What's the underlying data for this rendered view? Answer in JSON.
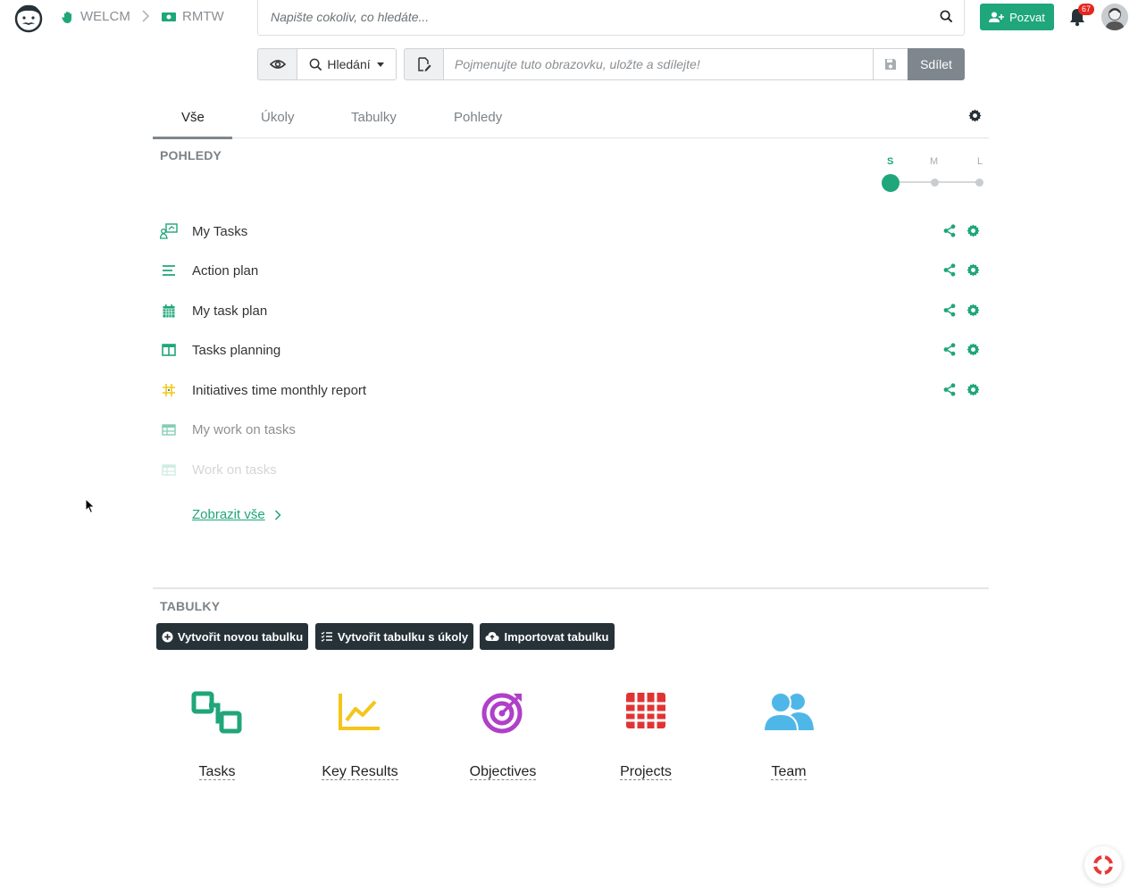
{
  "breadcrumb": {
    "workspace": "WELCM",
    "project": "RMTW"
  },
  "search": {
    "placeholder": "Napište cokoliv, co hledáte..."
  },
  "header": {
    "invite_label": "Pozvat",
    "notification_count": "67"
  },
  "toolbar": {
    "search_mode_label": "Hledání",
    "name_placeholder": "Pojmenujte tuto obrazovku, uložte a sdílejte!",
    "share_label": "Sdílet"
  },
  "tabs": [
    {
      "label": "Vše",
      "active": true
    },
    {
      "label": "Úkoly",
      "active": false
    },
    {
      "label": "Tabulky",
      "active": false
    },
    {
      "label": "Pohledy",
      "active": false
    }
  ],
  "views_section": {
    "title": "POHLEDY",
    "sizes": [
      "S",
      "M",
      "L"
    ],
    "selected_size": "S",
    "items": [
      {
        "label": "My Tasks",
        "icon": "task-board-icon"
      },
      {
        "label": "Action plan",
        "icon": "list-lines-icon"
      },
      {
        "label": "My task plan",
        "icon": "calendar-icon"
      },
      {
        "label": "Tasks planning",
        "icon": "columns-icon"
      },
      {
        "label": "Initiatives time monthly report",
        "icon": "pivot-grid-icon"
      },
      {
        "label": "My work on tasks",
        "icon": "table-icon"
      },
      {
        "label": "Work on tasks",
        "icon": "table-icon"
      }
    ],
    "show_all_label": "Zobrazit vše"
  },
  "tables_section": {
    "title": "TABULKY",
    "buttons": [
      {
        "label": "Vytvořit novou tabulku"
      },
      {
        "label": "Vytvořit tabulku s úkoly"
      },
      {
        "label": "Importovat tabulku"
      }
    ],
    "tiles": [
      {
        "label": "Tasks",
        "icon": "tasks-icon",
        "color": "#1fa67a"
      },
      {
        "label": "Key Results",
        "icon": "line-chart-icon",
        "color": "#f5c518"
      },
      {
        "label": "Objectives",
        "icon": "target-icon",
        "color": "#b03fc9"
      },
      {
        "label": "Projects",
        "icon": "grid-icon",
        "color": "#e03434"
      },
      {
        "label": "Team",
        "icon": "users-icon",
        "color": "#4fb7e8"
      }
    ]
  },
  "colors": {
    "accent": "#1fa67a",
    "dark_button": "#263238",
    "share_button": "#7e878d"
  }
}
